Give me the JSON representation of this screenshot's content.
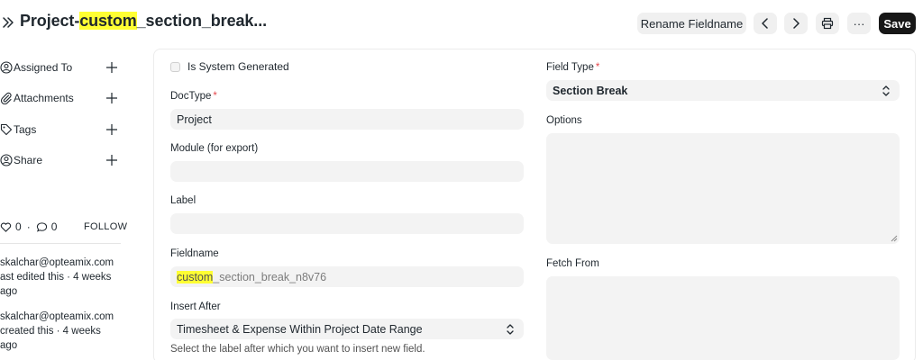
{
  "header": {
    "title_prefix": "Project-",
    "title_highlight": "custom",
    "title_suffix": "_section_break...",
    "rename_label": "Rename Fieldname",
    "more_label": "···",
    "save_label": "Save"
  },
  "sidebar": {
    "items": [
      {
        "label": "Assigned To",
        "icon": "user-assign-icon"
      },
      {
        "label": "Attachments",
        "icon": "paperclip-icon"
      },
      {
        "label": "Tags",
        "icon": "tag-icon"
      },
      {
        "label": "Share",
        "icon": "share-icon"
      }
    ],
    "likes": "0",
    "comments": "0",
    "dot": "·",
    "follow_label": "FOLLOW",
    "activity": [
      {
        "user": "skalchar@opteamix.com",
        "line2": "ast edited this · 4 weeks",
        "line3": "ago"
      },
      {
        "user": "skalchar@opteamix.com",
        "line2": "created this · 4 weeks ago"
      }
    ]
  },
  "form": {
    "is_system_generated_label": "Is System Generated",
    "doctype": {
      "label": "DocType",
      "required": "*",
      "value": "Project"
    },
    "module": {
      "label": "Module (for export)",
      "value": ""
    },
    "label": {
      "label": "Label",
      "value": ""
    },
    "fieldname": {
      "label": "Fieldname",
      "value_highlight": "custom",
      "value_rest": "_section_break_n8v76"
    },
    "insert_after": {
      "label": "Insert After",
      "value": "Timesheet & Expense Within Project Date Range",
      "help": "Select the label after which you want to insert new field."
    },
    "field_type": {
      "label": "Field Type",
      "required": "*",
      "value": "Section Break"
    },
    "options": {
      "label": "Options"
    },
    "fetch_from": {
      "label": "Fetch From"
    }
  }
}
